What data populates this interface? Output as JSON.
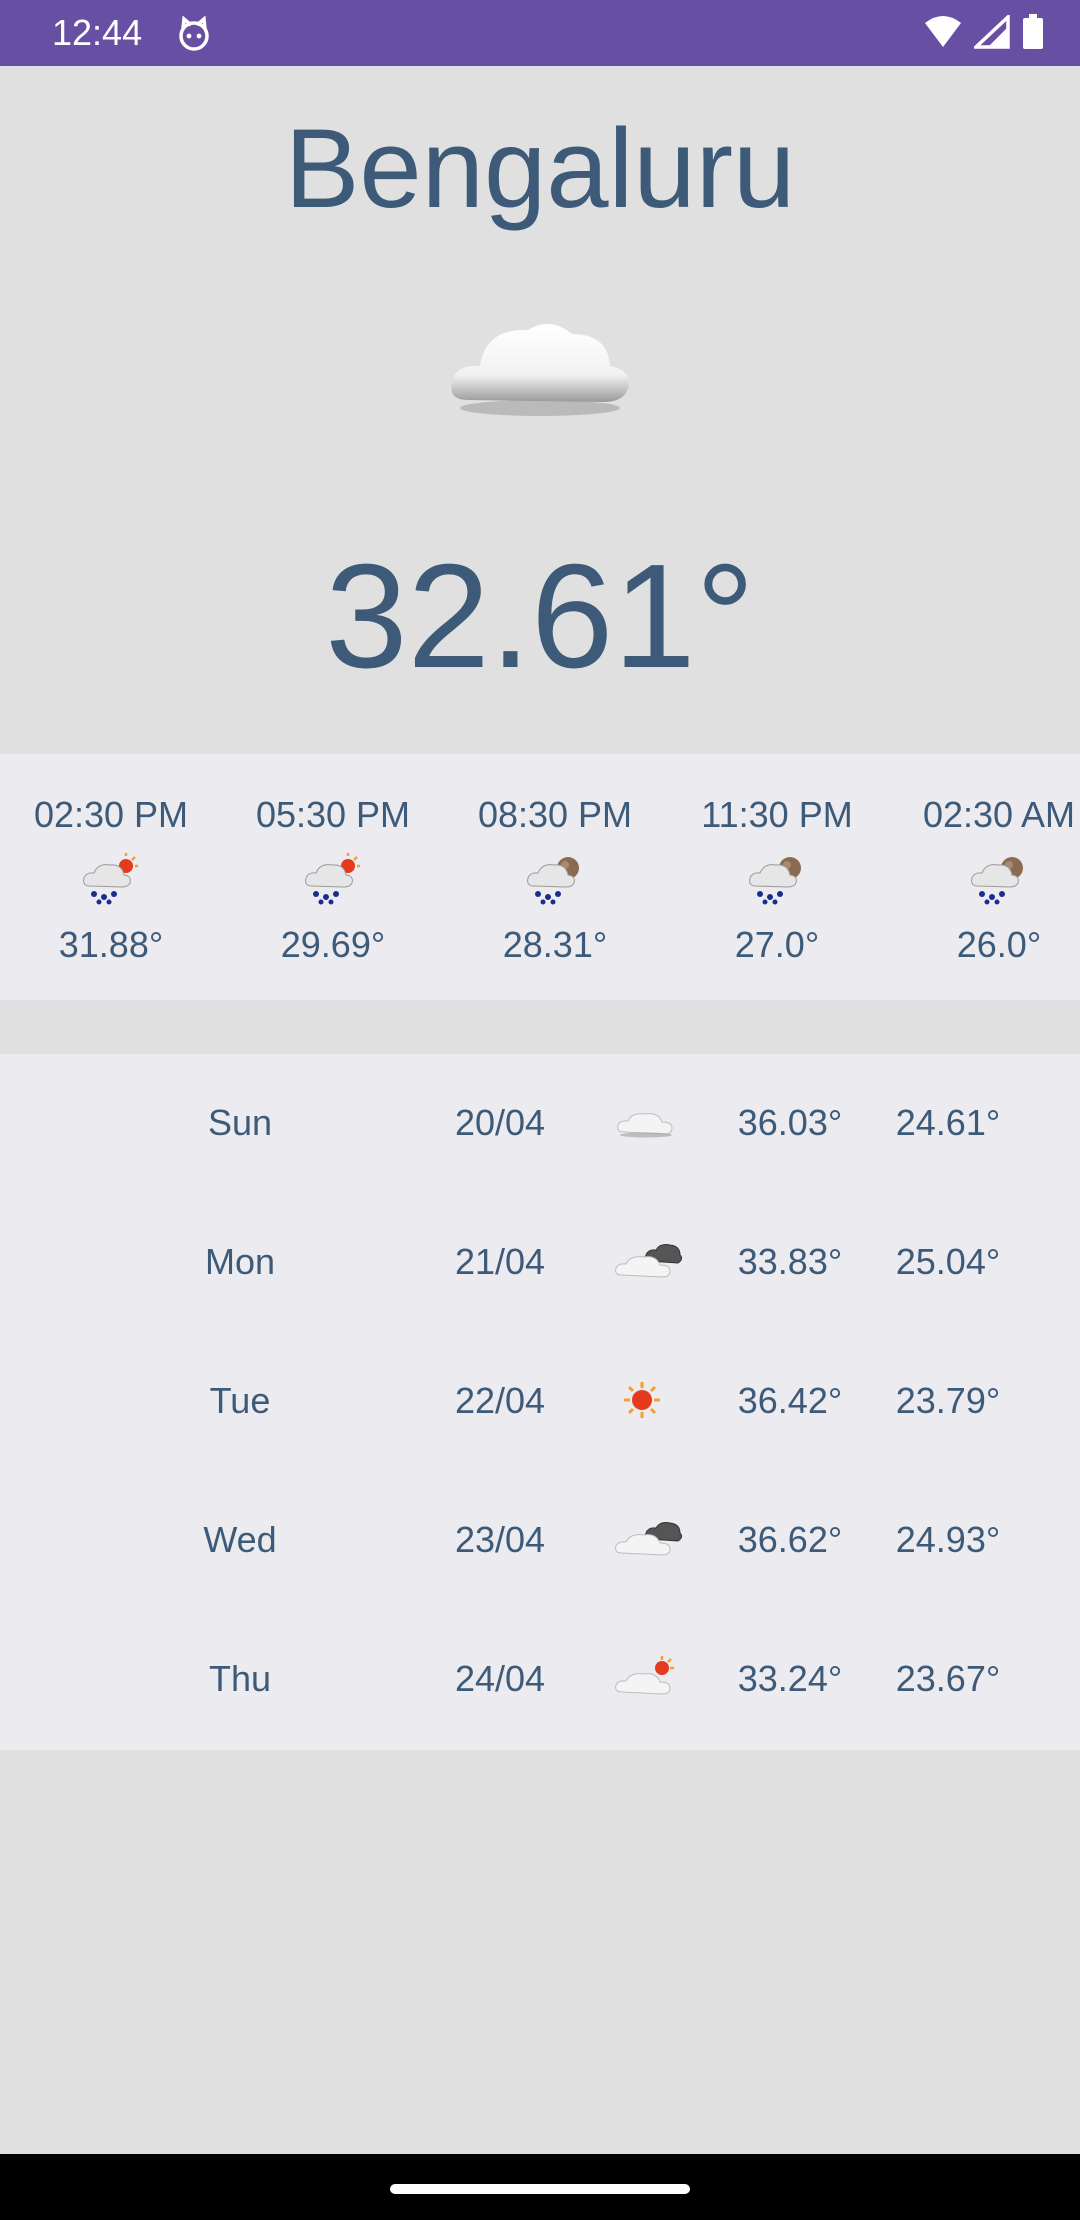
{
  "status_bar": {
    "time": "12:44",
    "icons": [
      "cat-face-icon",
      "wifi-icon",
      "cell-signal-icon",
      "battery-icon"
    ],
    "background": "#6750a4"
  },
  "city": "Bengaluru",
  "current": {
    "icon": "cloud-icon",
    "temperature": "32.61°"
  },
  "hourly": [
    {
      "time": "02:30 PM",
      "icon": "rain-sun-icon",
      "temp": "31.88°"
    },
    {
      "time": "05:30 PM",
      "icon": "rain-sun-icon",
      "temp": "29.69°"
    },
    {
      "time": "08:30 PM",
      "icon": "rain-night-icon",
      "temp": "28.31°"
    },
    {
      "time": "11:30 PM",
      "icon": "rain-night-icon",
      "temp": "27.0°"
    },
    {
      "time": "02:30 AM",
      "icon": "rain-night-icon",
      "temp": "26.0°"
    }
  ],
  "daily": [
    {
      "day": "Sun",
      "date": "20/04",
      "icon": "cloud-icon",
      "max": "36.03°",
      "min": "24.61°"
    },
    {
      "day": "Mon",
      "date": "21/04",
      "icon": "dark-cloud-icon",
      "max": "33.83°",
      "min": "25.04°"
    },
    {
      "day": "Tue",
      "date": "22/04",
      "icon": "sun-icon",
      "max": "36.42°",
      "min": "23.79°"
    },
    {
      "day": "Wed",
      "date": "23/04",
      "icon": "dark-cloud-icon",
      "max": "36.62°",
      "min": "24.93°"
    },
    {
      "day": "Thu",
      "date": "24/04",
      "icon": "cloud-sun-icon",
      "max": "33.24°",
      "min": "23.67°"
    }
  ],
  "colors": {
    "text": "#3d5a78",
    "page_bg": "#e0e0e0",
    "panel_bg": "#ebebf0"
  }
}
